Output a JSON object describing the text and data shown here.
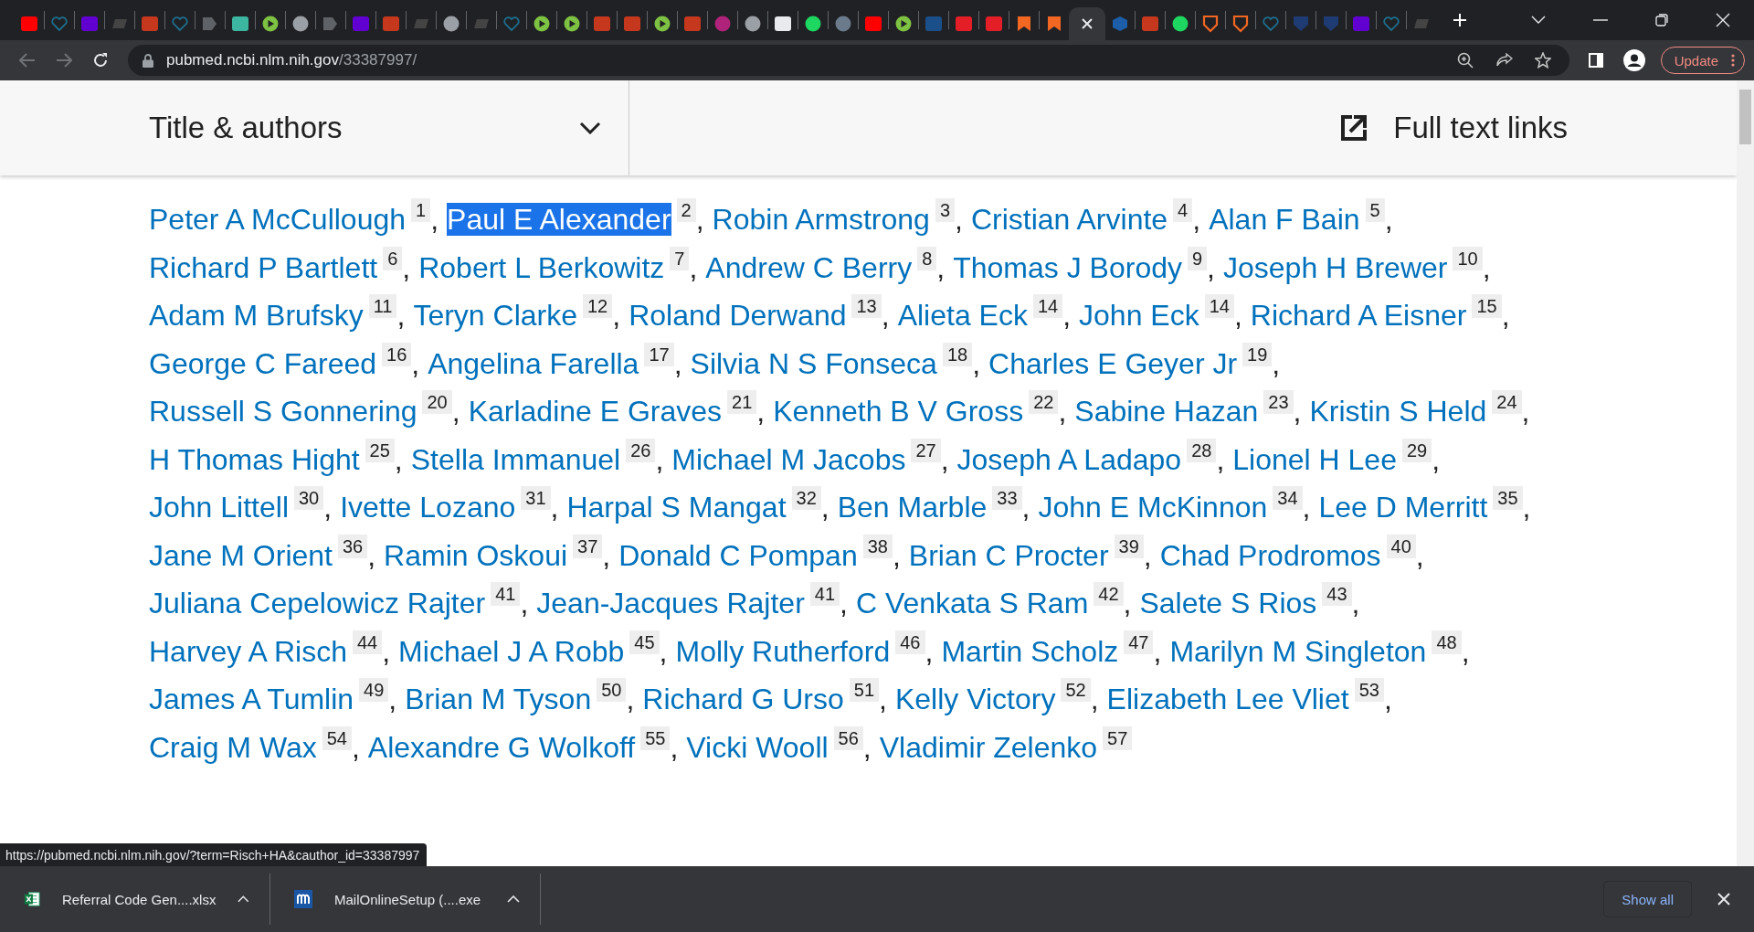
{
  "tabs": [
    {
      "kind": "youtube",
      "selected": false
    },
    {
      "kind": "heart",
      "selected": false
    },
    {
      "kind": "yahoo",
      "selected": false
    },
    {
      "kind": "dr",
      "selected": false
    },
    {
      "kind": "bi",
      "selected": false
    },
    {
      "kind": "heart",
      "selected": false
    },
    {
      "kind": "arrow",
      "selected": false
    },
    {
      "kind": "puzzle",
      "selected": false
    },
    {
      "kind": "play",
      "selected": false
    },
    {
      "kind": "globe",
      "selected": false
    },
    {
      "kind": "arrow",
      "selected": false
    },
    {
      "kind": "yahoo",
      "selected": false
    },
    {
      "kind": "bi",
      "selected": false
    },
    {
      "kind": "dr",
      "selected": false
    },
    {
      "kind": "globe",
      "selected": false
    },
    {
      "kind": "dr",
      "selected": false
    },
    {
      "kind": "heart",
      "selected": false
    },
    {
      "kind": "play",
      "selected": false
    },
    {
      "kind": "play",
      "selected": false
    },
    {
      "kind": "bi",
      "selected": false
    },
    {
      "kind": "bi",
      "selected": false
    },
    {
      "kind": "play",
      "selected": false
    },
    {
      "kind": "bi",
      "selected": false
    },
    {
      "kind": "swirl",
      "selected": false
    },
    {
      "kind": "globe",
      "selected": false
    },
    {
      "kind": "nw",
      "selected": false
    },
    {
      "kind": "g",
      "selected": false
    },
    {
      "kind": "avatar",
      "selected": false
    },
    {
      "kind": "youtube",
      "selected": false
    },
    {
      "kind": "play",
      "selected": false
    },
    {
      "kind": "drblue",
      "selected": false
    },
    {
      "kind": "torch",
      "selected": false
    },
    {
      "kind": "torch",
      "selected": false
    },
    {
      "kind": "bookmark",
      "selected": false
    },
    {
      "kind": "bookmark",
      "selected": false
    },
    {
      "selected": true
    },
    {
      "kind": "cube",
      "selected": false
    },
    {
      "kind": "bi",
      "selected": false
    },
    {
      "kind": "g",
      "selected": false
    },
    {
      "kind": "shield",
      "selected": false
    },
    {
      "kind": "shield",
      "selected": false
    },
    {
      "kind": "heart",
      "selected": false
    },
    {
      "kind": "crest",
      "selected": false
    },
    {
      "kind": "crest",
      "selected": false
    },
    {
      "kind": "yahoo",
      "selected": false
    },
    {
      "kind": "heart",
      "selected": false
    },
    {
      "kind": "dr",
      "selected": false
    }
  ],
  "address": {
    "host": "pubmed.ncbi.nlm.nih.gov",
    "path": "/33387997/"
  },
  "update_button": "Update",
  "header": {
    "title": "Title & authors",
    "links": "Full text links"
  },
  "authors": [
    {
      "name": "Peter A McCullough",
      "ref": "1",
      "punct": ",",
      "selected": false
    },
    {
      "name": "Paul E Alexander",
      "ref": "2",
      "punct": ",",
      "selected": true
    },
    {
      "name": "Robin Armstrong",
      "ref": "3",
      "punct": ",",
      "selected": false
    },
    {
      "name": "Cristian Arvinte",
      "ref": "4",
      "punct": ",",
      "selected": false
    },
    {
      "name": "Alan F Bain",
      "ref": "5",
      "punct": ",",
      "selected": false
    },
    {
      "name": "Richard P Bartlett",
      "ref": "6",
      "punct": ",",
      "selected": false
    },
    {
      "name": "Robert L Berkowitz",
      "ref": "7",
      "punct": ",",
      "selected": false
    },
    {
      "name": "Andrew C Berry",
      "ref": "8",
      "punct": ",",
      "selected": false
    },
    {
      "name": "Thomas J Borody",
      "ref": "9",
      "punct": ",",
      "selected": false
    },
    {
      "name": "Joseph H Brewer",
      "ref": "10",
      "punct": ",",
      "selected": false
    },
    {
      "name": "Adam M Brufsky",
      "ref": "11",
      "punct": ",",
      "selected": false
    },
    {
      "name": "Teryn Clarke",
      "ref": "12",
      "punct": ",",
      "selected": false
    },
    {
      "name": "Roland Derwand",
      "ref": "13",
      "punct": ",",
      "selected": false
    },
    {
      "name": "Alieta Eck",
      "ref": "14",
      "punct": ",",
      "selected": false
    },
    {
      "name": "John Eck",
      "ref": "14",
      "punct": ",",
      "selected": false
    },
    {
      "name": "Richard A Eisner",
      "ref": "15",
      "punct": ",",
      "selected": false
    },
    {
      "name": "George C Fareed",
      "ref": "16",
      "punct": ",",
      "selected": false
    },
    {
      "name": "Angelina Farella",
      "ref": "17",
      "punct": ",",
      "selected": false
    },
    {
      "name": "Silvia N S Fonseca",
      "ref": "18",
      "punct": ",",
      "selected": false
    },
    {
      "name": "Charles E Geyer Jr",
      "ref": "19",
      "punct": ",",
      "selected": false
    },
    {
      "name": "Russell S Gonnering",
      "ref": "20",
      "punct": ",",
      "selected": false
    },
    {
      "name": "Karladine E Graves",
      "ref": "21",
      "punct": ",",
      "selected": false
    },
    {
      "name": "Kenneth B V Gross",
      "ref": "22",
      "punct": ",",
      "selected": false
    },
    {
      "name": "Sabine Hazan",
      "ref": "23",
      "punct": ",",
      "selected": false
    },
    {
      "name": "Kristin S Held",
      "ref": "24",
      "punct": ",",
      "selected": false
    },
    {
      "name": "H Thomas Hight",
      "ref": "25",
      "punct": ",",
      "selected": false
    },
    {
      "name": "Stella Immanuel",
      "ref": "26",
      "punct": ",",
      "selected": false
    },
    {
      "name": "Michael M Jacobs",
      "ref": "27",
      "punct": ",",
      "selected": false
    },
    {
      "name": "Joseph A Ladapo",
      "ref": "28",
      "punct": ",",
      "selected": false
    },
    {
      "name": "Lionel H Lee",
      "ref": "29",
      "punct": ",",
      "selected": false
    },
    {
      "name": "John Littell",
      "ref": "30",
      "punct": ",",
      "selected": false
    },
    {
      "name": "Ivette Lozano",
      "ref": "31",
      "punct": ",",
      "selected": false
    },
    {
      "name": "Harpal S Mangat",
      "ref": "32",
      "punct": ",",
      "selected": false
    },
    {
      "name": "Ben Marble",
      "ref": "33",
      "punct": ",",
      "selected": false
    },
    {
      "name": "John E McKinnon",
      "ref": "34",
      "punct": ",",
      "selected": false
    },
    {
      "name": "Lee D Merritt",
      "ref": "35",
      "punct": ",",
      "selected": false
    },
    {
      "name": "Jane M Orient",
      "ref": "36",
      "punct": ",",
      "selected": false
    },
    {
      "name": "Ramin Oskoui",
      "ref": "37",
      "punct": ",",
      "selected": false
    },
    {
      "name": "Donald C Pompan",
      "ref": "38",
      "punct": ",",
      "selected": false
    },
    {
      "name": "Brian C Procter",
      "ref": "39",
      "punct": ",",
      "selected": false
    },
    {
      "name": "Chad Prodromos",
      "ref": "40",
      "punct": ",",
      "selected": false
    },
    {
      "name": "Juliana Cepelowicz Rajter",
      "ref": "41",
      "punct": ",",
      "selected": false
    },
    {
      "name": "Jean-Jacques Rajter",
      "ref": "41",
      "punct": ",",
      "selected": false
    },
    {
      "name": "C Venkata S Ram",
      "ref": "42",
      "punct": ",",
      "selected": false
    },
    {
      "name": "Salete S Rios",
      "ref": "43",
      "punct": ",",
      "selected": false
    },
    {
      "name": "Harvey A Risch",
      "ref": "44",
      "punct": ",",
      "selected": false
    },
    {
      "name": "Michael J A Robb",
      "ref": "45",
      "punct": ",",
      "selected": false
    },
    {
      "name": "Molly Rutherford",
      "ref": "46",
      "punct": ",",
      "selected": false
    },
    {
      "name": "Martin Scholz",
      "ref": "47",
      "punct": ",",
      "selected": false
    },
    {
      "name": "Marilyn M Singleton",
      "ref": "48",
      "punct": ",",
      "selected": false
    },
    {
      "name": "James A Tumlin",
      "ref": "49",
      "punct": ",",
      "selected": false
    },
    {
      "name": "Brian M Tyson",
      "ref": "50",
      "punct": ",",
      "selected": false
    },
    {
      "name": "Richard G Urso",
      "ref": "51",
      "punct": ",",
      "selected": false
    },
    {
      "name": "Kelly Victory",
      "ref": "52",
      "punct": ",",
      "selected": false
    },
    {
      "name": "Elizabeth Lee Vliet",
      "ref": "53",
      "punct": ",",
      "selected": false
    },
    {
      "name": "Craig M Wax",
      "ref": "54",
      "punct": ",",
      "selected": false
    },
    {
      "name": "Alexandre G Wolkoff",
      "ref": "55",
      "punct": ",",
      "selected": false
    },
    {
      "name": "Vicki Wooll",
      "ref": "56",
      "punct": ",",
      "selected": false
    },
    {
      "name": "Vladimir Zelenko",
      "ref": "57",
      "selected": false
    }
  ],
  "status_url": "https://pubmed.ncbi.nlm.nih.gov/?term=Risch+HA&cauthor_id=33387997",
  "downloads": [
    {
      "kind": "excel",
      "name": "Referral Code Gen....xlsx"
    },
    {
      "kind": "mail",
      "name": "MailOnlineSetup (....exe"
    }
  ],
  "show_all": "Show all"
}
